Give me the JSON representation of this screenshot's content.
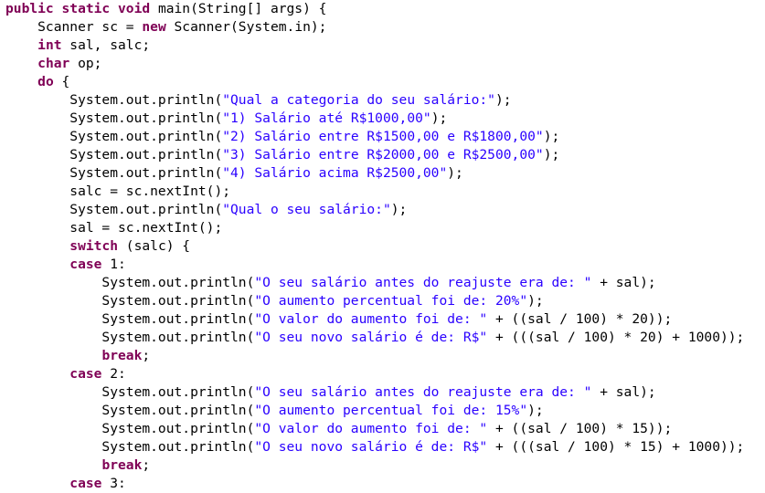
{
  "colors": {
    "keyword": "#7f0055",
    "string": "#2a00ff",
    "plain": "#000000",
    "background": "#ffffff"
  },
  "lines": [
    [
      [
        "kw",
        "public static void"
      ],
      [
        "pl",
        " main(String[] args) {"
      ]
    ],
    [
      [
        "pl",
        "    Scanner sc = "
      ],
      [
        "kw",
        "new"
      ],
      [
        "pl",
        " Scanner(System.in);"
      ]
    ],
    [
      [
        "pl",
        "    "
      ],
      [
        "kw",
        "int"
      ],
      [
        "pl",
        " sal, salc;"
      ]
    ],
    [
      [
        "pl",
        "    "
      ],
      [
        "kw",
        "char"
      ],
      [
        "pl",
        " op;"
      ]
    ],
    [
      [
        "pl",
        "    "
      ],
      [
        "kw",
        "do"
      ],
      [
        "pl",
        " {"
      ]
    ],
    [
      [
        "pl",
        "        System.out.println("
      ],
      [
        "str",
        "\"Qual a categoria do seu salário:\""
      ],
      [
        "pl",
        ");"
      ]
    ],
    [
      [
        "pl",
        "        System.out.println("
      ],
      [
        "str",
        "\"1) Salário até R$1000,00\""
      ],
      [
        "pl",
        ");"
      ]
    ],
    [
      [
        "pl",
        "        System.out.println("
      ],
      [
        "str",
        "\"2) Salário entre R$1500,00 e R$1800,00\""
      ],
      [
        "pl",
        ");"
      ]
    ],
    [
      [
        "pl",
        "        System.out.println("
      ],
      [
        "str",
        "\"3) Salário entre R$2000,00 e R$2500,00\""
      ],
      [
        "pl",
        ");"
      ]
    ],
    [
      [
        "pl",
        "        System.out.println("
      ],
      [
        "str",
        "\"4) Salário acima R$2500,00\""
      ],
      [
        "pl",
        ");"
      ]
    ],
    [
      [
        "pl",
        "        salc = sc.nextInt();"
      ]
    ],
    [
      [
        "pl",
        "        System.out.println("
      ],
      [
        "str",
        "\"Qual o seu salário:\""
      ],
      [
        "pl",
        ");"
      ]
    ],
    [
      [
        "pl",
        "        sal = sc.nextInt();"
      ]
    ],
    [
      [
        "pl",
        "        "
      ],
      [
        "kw",
        "switch"
      ],
      [
        "pl",
        " (salc) {"
      ]
    ],
    [
      [
        "pl",
        "        "
      ],
      [
        "kw",
        "case"
      ],
      [
        "pl",
        " 1:"
      ]
    ],
    [
      [
        "pl",
        "            System.out.println("
      ],
      [
        "str",
        "\"O seu salário antes do reajuste era de: \""
      ],
      [
        "pl",
        " + sal);"
      ]
    ],
    [
      [
        "pl",
        "            System.out.println("
      ],
      [
        "str",
        "\"O aumento percentual foi de: 20%\""
      ],
      [
        "pl",
        ");"
      ]
    ],
    [
      [
        "pl",
        "            System.out.println("
      ],
      [
        "str",
        "\"O valor do aumento foi de: \""
      ],
      [
        "pl",
        " + ((sal / 100) * 20));"
      ]
    ],
    [
      [
        "pl",
        "            System.out.println("
      ],
      [
        "str",
        "\"O seu novo salário é de: R$\""
      ],
      [
        "pl",
        " + (((sal / 100) * 20) + 1000));"
      ]
    ],
    [
      [
        "pl",
        "            "
      ],
      [
        "kw",
        "break"
      ],
      [
        "pl",
        ";"
      ]
    ],
    [
      [
        "pl",
        "        "
      ],
      [
        "kw",
        "case"
      ],
      [
        "pl",
        " 2:"
      ]
    ],
    [
      [
        "pl",
        "            System.out.println("
      ],
      [
        "str",
        "\"O seu salário antes do reajuste era de: \""
      ],
      [
        "pl",
        " + sal);"
      ]
    ],
    [
      [
        "pl",
        "            System.out.println("
      ],
      [
        "str",
        "\"O aumento percentual foi de: 15%\""
      ],
      [
        "pl",
        ");"
      ]
    ],
    [
      [
        "pl",
        "            System.out.println("
      ],
      [
        "str",
        "\"O valor do aumento foi de: \""
      ],
      [
        "pl",
        " + ((sal / 100) * 15));"
      ]
    ],
    [
      [
        "pl",
        "            System.out.println("
      ],
      [
        "str",
        "\"O seu novo salário é de: R$\""
      ],
      [
        "pl",
        " + (((sal / 100) * 15) + 1000));"
      ]
    ],
    [
      [
        "pl",
        "            "
      ],
      [
        "kw",
        "break"
      ],
      [
        "pl",
        ";"
      ]
    ],
    [
      [
        "pl",
        "        "
      ],
      [
        "kw",
        "case"
      ],
      [
        "pl",
        " 3:"
      ]
    ]
  ]
}
